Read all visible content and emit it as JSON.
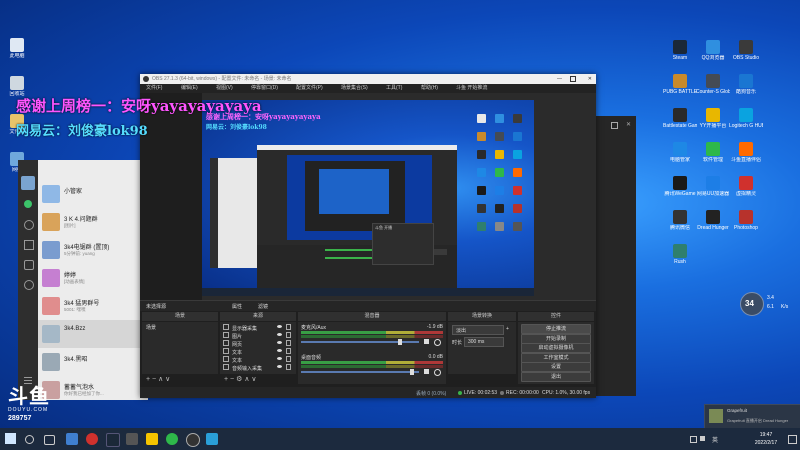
{
  "overlay": {
    "line1": "感谢上周榜一：安呀yayayayayaya",
    "line2": "网易云：刘俊豪lok98",
    "line1_color": "#ff55ff",
    "line2_color": "#55ddff"
  },
  "watermark": {
    "logo_text": "斗鱼",
    "logo_sub": "DOUYU.COM",
    "room_id": "289757"
  },
  "desktop_left_icons": [
    {
      "label": "此电脑",
      "color": "#dfe8f3"
    },
    {
      "label": "回收站",
      "color": "#cfd8e0"
    },
    {
      "label": "文件夹",
      "color": "#e8c46a"
    },
    {
      "label": "网络",
      "color": "#6fa8dc"
    }
  ],
  "desktop_right_icons": [
    {
      "label": "Steam",
      "color": "#1b2838"
    },
    {
      "label": "QQ浏览器",
      "color": "#2f8fe0"
    },
    {
      "label": "OBS Studio",
      "color": "#3a3a3a"
    },
    {
      "label": "PUBG BATTLEGR...",
      "color": "#c98a2b"
    },
    {
      "label": "Counter-S Global Of...",
      "color": "#444b55"
    },
    {
      "label": "酷狗音乐",
      "color": "#1a76d2"
    },
    {
      "label": "Battlestate Games L...",
      "color": "#2a2a2a"
    },
    {
      "label": "YY开播平台",
      "color": "#e8b700"
    },
    {
      "label": "Logitech G HUB",
      "color": "#0aa3e0"
    },
    {
      "label": "电脑管家",
      "color": "#1e88e5"
    },
    {
      "label": "软件管理",
      "color": "#2eb84a"
    },
    {
      "label": "斗鱼直播伴侣",
      "color": "#ff6a00"
    },
    {
      "label": "腾讯WeGame",
      "color": "#1a1a1a"
    },
    {
      "label": "网易UU加速器",
      "color": "#1d7ee6"
    },
    {
      "label": "虚拟精灵",
      "color": "#d0312d"
    },
    {
      "label": "腾讯微信",
      "color": "#333333"
    },
    {
      "label": "Dread Hunger",
      "color": "#222222"
    },
    {
      "label": "Photoshop",
      "color": "#b7322c"
    },
    {
      "label": "Rush",
      "color": "#2f7f6e"
    }
  ],
  "chat": {
    "items": [
      {
        "name": "小管家",
        "msg": "",
        "avatar_color": "#8fb8e6"
      },
      {
        "name": "3 K 4.问题群",
        "msg": "[图片]",
        "avatar_color": "#d9a35a"
      },
      {
        "name": "3k4电锯群 (置顶)",
        "msg": "5分钟前: yuang",
        "avatar_color": "#7a9ccf"
      },
      {
        "name": "婷婷",
        "msg": "[动画表情]",
        "avatar_color": "#c57fd1"
      },
      {
        "name": "3k4 猛男群号",
        "msg": "5001: 嘿嘿",
        "avatar_color": "#e08d8d"
      },
      {
        "name": "3k4.Bzz",
        "msg": "",
        "avatar_color": "#a5b8c7"
      },
      {
        "name": "3k4.黑昭",
        "msg": "",
        "avatar_color": "#9aa9b5"
      },
      {
        "name": "蓄蓄气泡水",
        "msg": "你好我已经加了你...",
        "avatar_color": "#c9a0a0"
      }
    ]
  },
  "obs": {
    "title": "OBS 27.1.3 (64-bit, windows) - 配置文件: 未命名 - 场景: 未命名",
    "menu": [
      "文件(F)",
      "编辑(E)",
      "视图(V)",
      "停靠窗口(D)",
      "配置文件(P)",
      "场景集合(S)",
      "工具(T)",
      "帮助(H)",
      "斗鱼 开始推流"
    ],
    "filters_label": "滤镜",
    "properties_label": "属性",
    "no_source": "未选择源",
    "docks": {
      "scenes": "场景",
      "sources": "来源",
      "mixer": "混音器",
      "transitions": "场景转换",
      "controls": "控件"
    },
    "scene_item": "场景",
    "sources": [
      "显示器采集",
      "图片",
      "网页",
      "文本",
      "文本",
      "音频输入采集"
    ],
    "mixer": [
      {
        "name": "麦克风/Aux",
        "db": "-1.9 dB"
      },
      {
        "name": "桌面音频",
        "db": "0.0 dB"
      }
    ],
    "transition": {
      "type": "淡出",
      "duration_label": "时长",
      "duration": "300 ms"
    },
    "controls": [
      "停止推流",
      "开始录制",
      "启动虚拟摄像机",
      "工作室模式",
      "设置",
      "退出"
    ],
    "status": {
      "dropped": "丢帧 0 (0.0%)",
      "live": "LIVE: 00:02:53",
      "rec": "REC: 00:00:00",
      "cpu": "CPU: 1.0%, 30.00 fps"
    }
  },
  "nested_preview": {
    "overlay_line1": "感谢上周榜一：安呀yayayayayaya",
    "overlay_line2": "网易云：刘俊豪lok98",
    "inner_title": "斗鱼 开播"
  },
  "notification": {
    "title": "Grapefruit",
    "line1": "Grapefruit 直播开启 Dread Hunger"
  },
  "weather": {
    "temp": "34",
    "speed1": "3.4",
    "speed2": "6.1",
    "unit": "K/s"
  },
  "tray": {
    "time": "19:47",
    "date": "2022/2/17",
    "lang": "英"
  }
}
